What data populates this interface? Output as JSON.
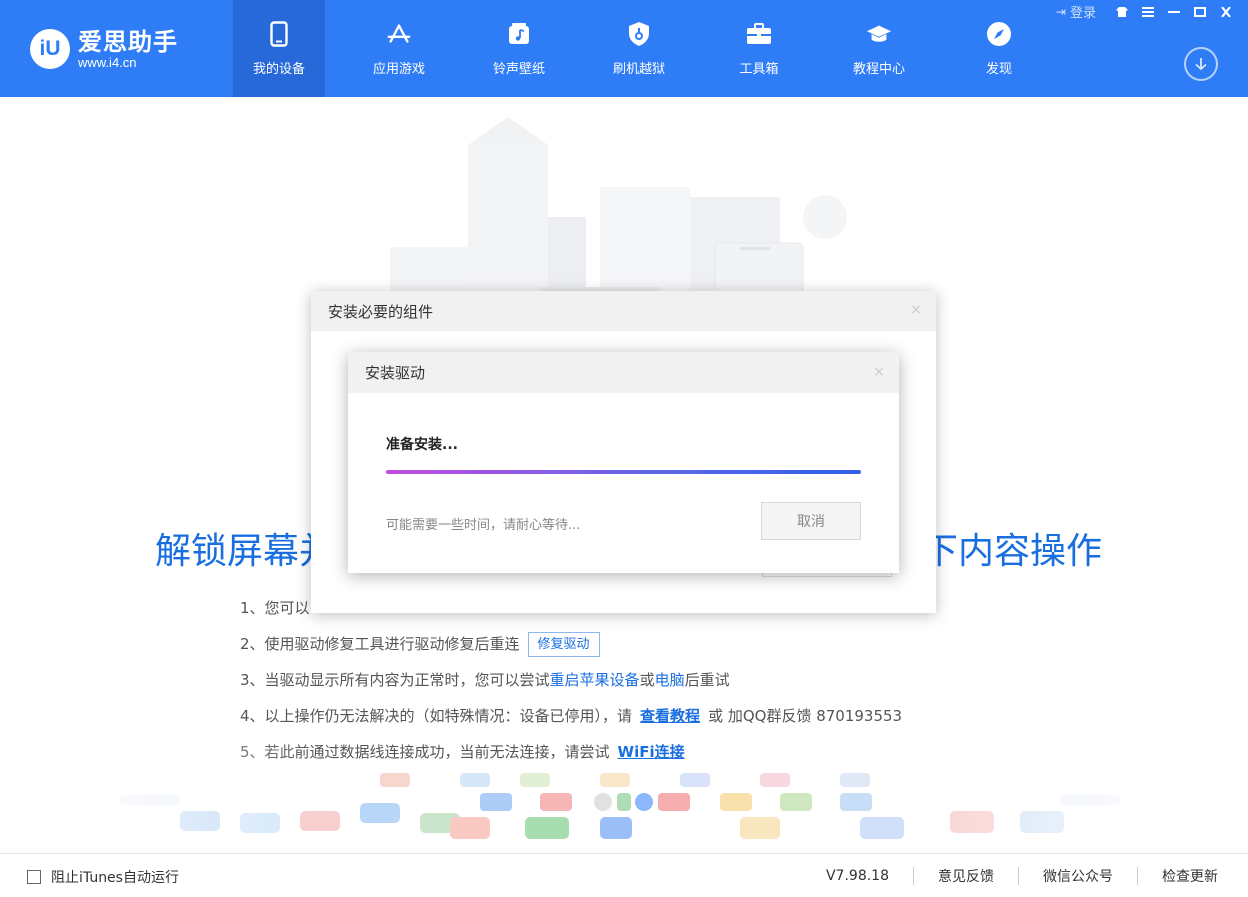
{
  "app": {
    "name": "爱思助手",
    "url": "www.i4.cn",
    "logo_mark": "iU"
  },
  "topbar": {
    "login_label": "登录",
    "login_icon": "login-icon"
  },
  "nav": {
    "items": [
      {
        "label": "我的设备",
        "icon": "phone-icon",
        "active": true
      },
      {
        "label": "应用游戏",
        "icon": "appstore-icon",
        "active": false
      },
      {
        "label": "铃声壁纸",
        "icon": "music-icon",
        "active": false
      },
      {
        "label": "刷机越狱",
        "icon": "shield-icon",
        "active": false
      },
      {
        "label": "工具箱",
        "icon": "toolbox-icon",
        "active": false
      },
      {
        "label": "教程中心",
        "icon": "graduation-cap-icon",
        "active": false
      },
      {
        "label": "发现",
        "icon": "compass-icon",
        "active": false
      }
    ]
  },
  "main": {
    "headline_left": "解锁屏幕并",
    "headline_right": "下内容操作",
    "steps": {
      "s1": "1、您可以",
      "s2_text": "2、使用驱动修复工具进行驱动修复后重连",
      "s2_button": "修复驱动",
      "s3_pre": "3、当驱动显示所有内容为正常时，您可以尝试",
      "s3_link1": "重启苹果设备",
      "s3_mid": "或",
      "s3_link2": "电脑",
      "s3_post": "后重试",
      "s4_pre": "4、以上操作仍无法解决的（如特殊情况：设备已停用），请",
      "s4_link": "查看教程",
      "s4_post": "或 加QQ群反馈 870193553",
      "s5_pre": "5、若此前通过数据线连接成功，当前无法连接，请尝试",
      "s5_link": "WiFi连接"
    }
  },
  "dialog_outer": {
    "title": "安装必要的组件",
    "close": "×"
  },
  "dialog_inner": {
    "title": "安装驱动",
    "close": "×",
    "status": "准备安装...",
    "progress": 1.0,
    "hint": "可能需要一些时间，请耐心等待...",
    "cancel_label": "取消"
  },
  "footer": {
    "itunes_label": "阻止iTunes自动运行",
    "itunes_checked": false,
    "version": "V7.98.18",
    "feedback": "意见反馈",
    "wechat": "微信公众号",
    "update": "检查更新"
  },
  "colors": {
    "brand": "#2f7df6",
    "nav_active": "#2769d8",
    "link": "#1a6fe0"
  }
}
